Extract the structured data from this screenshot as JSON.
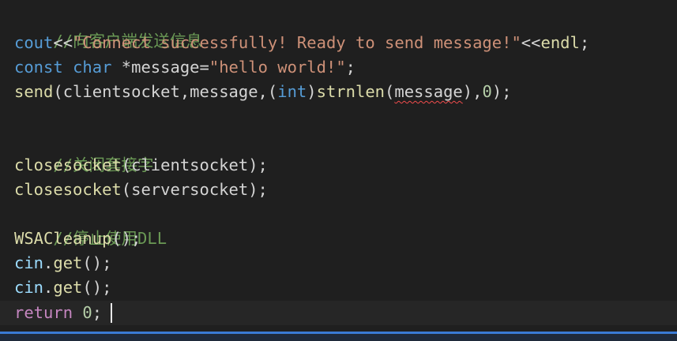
{
  "lines": {
    "l1": {
      "comment": "//向客户端发送信息"
    },
    "l2": {
      "cout": "cout",
      "op1": "<<",
      "str": "\"Connect successfully! Ready to send message!\"",
      "op2": "<<",
      "endl": "endl",
      "end": ";"
    },
    "l3": {
      "kw1": "const",
      "sp1": " ",
      "kw2": "char",
      "sp2": " ",
      "rest": "*message=",
      "str": "\"hello world!\"",
      "end": ";"
    },
    "l4": {
      "func": "send",
      "p1": "(clientsocket,message,(",
      "kw": "int",
      "p2": ")",
      "func2": "strnlen",
      "p3": "(",
      "arg": "message",
      "p4": "),",
      "num": "0",
      "p5": ");"
    },
    "l6": {
      "comment": "//关闭套接字"
    },
    "l7": {
      "func": "closesocket",
      "rest": "(clientsocket);"
    },
    "l8": {
      "func": "closesocket",
      "rest": "(serversocket);"
    },
    "l9": {
      "comment": "//停止使用DLL"
    },
    "l10": {
      "func": "WSACleanup",
      "rest": "();"
    },
    "l11": {
      "obj": "cin",
      "dot": ".",
      "func": "get",
      "rest": "();"
    },
    "l12": {
      "obj": "cin",
      "dot": ".",
      "func": "get",
      "rest": "();"
    },
    "l13": {
      "kw": "return",
      "sp": " ",
      "num": "0",
      "end": ";"
    }
  },
  "colors": {
    "background": "#1e1e1e",
    "comment": "#6a9955",
    "string": "#ce9178",
    "keyword": "#569cd6",
    "function": "#dcdcaa",
    "accent": "#3a7bd5"
  }
}
